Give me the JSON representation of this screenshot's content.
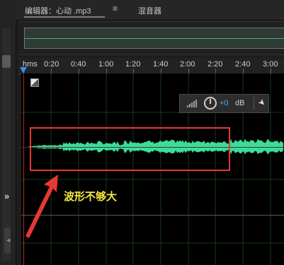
{
  "tabs": {
    "editor_label": "编辑器：心动 .mp3",
    "mixer_label": "混音器"
  },
  "ruler": {
    "unit": "hms",
    "ticks": [
      "0:20",
      "0:40",
      "1:00",
      "1:20",
      "1:40",
      "2:00",
      "2:20",
      "2:40",
      "3:00"
    ]
  },
  "hud": {
    "volume_value": "+0",
    "volume_unit": "dB"
  },
  "annotation": {
    "text": "波形不够大"
  },
  "colors": {
    "waveform": "#3ddc97",
    "annotation_box": "#e53935",
    "annotation_text": "#f5e642",
    "playhead": "#3a8ee6",
    "hud_value": "#4aa8ff"
  },
  "icons": {
    "collapse": "double-chevron-right-icon",
    "tab_menu": "hamburger-menu-icon",
    "pin": "pin-icon",
    "volume_knob": "knob-icon",
    "level_meter": "level-meter-icon",
    "channel_toggle": "channel-toggle-icon"
  }
}
